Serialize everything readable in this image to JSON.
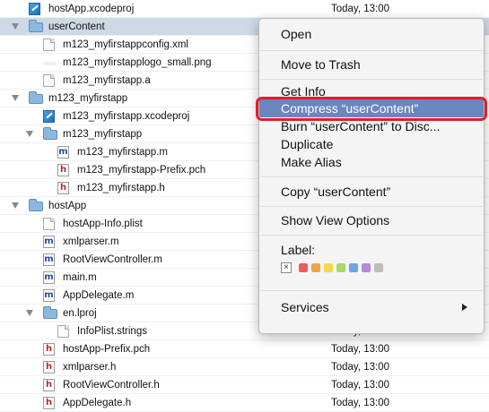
{
  "rows": [
    {
      "name": "hostApp.xcodeproj",
      "icon": "xcodeproj-icon",
      "date": "Today, 13:00",
      "indent": 0,
      "disclosure": "none"
    },
    {
      "name": "userContent",
      "icon": "folder-icon",
      "date": "",
      "indent": 0,
      "disclosure": "open",
      "selected": true
    },
    {
      "name": "m123_myfirstappconfig.xml",
      "icon": "document-icon",
      "date": "",
      "indent": 1,
      "disclosure": "none"
    },
    {
      "name": "m123_myfirstapplogo_small.png",
      "icon": "image-icon",
      "date": "",
      "indent": 1,
      "disclosure": "none"
    },
    {
      "name": "m123_myfirstapp.a",
      "icon": "document-icon",
      "date": "",
      "indent": 1,
      "disclosure": "none"
    },
    {
      "name": "m123_myfirstapp",
      "icon": "folder-icon",
      "date": "",
      "indent": 0,
      "disclosure": "open"
    },
    {
      "name": "m123_myfirstapp.xcodeproj",
      "icon": "xcodeproj-icon",
      "date": "",
      "indent": 1,
      "disclosure": "none"
    },
    {
      "name": "m123_myfirstapp",
      "icon": "folder-icon",
      "date": "",
      "indent": 1,
      "disclosure": "open"
    },
    {
      "name": "m123_myfirstapp.m",
      "icon": "m-file-icon",
      "date": "",
      "indent": 2,
      "disclosure": "none"
    },
    {
      "name": "m123_myfirstapp-Prefix.pch",
      "icon": "h-file-icon",
      "date": "",
      "indent": 2,
      "disclosure": "none"
    },
    {
      "name": "m123_myfirstapp.h",
      "icon": "h-file-icon",
      "date": "",
      "indent": 2,
      "disclosure": "none"
    },
    {
      "name": "hostApp",
      "icon": "folder-icon",
      "date": "",
      "indent": 0,
      "disclosure": "open"
    },
    {
      "name": "hostApp-Info.plist",
      "icon": "document-icon",
      "date": "",
      "indent": 1,
      "disclosure": "none"
    },
    {
      "name": "xmlparser.m",
      "icon": "m-file-icon",
      "date": "",
      "indent": 1,
      "disclosure": "none"
    },
    {
      "name": "RootViewController.m",
      "icon": "m-file-icon",
      "date": "",
      "indent": 1,
      "disclosure": "none"
    },
    {
      "name": "main.m",
      "icon": "m-file-icon",
      "date": "",
      "indent": 1,
      "disclosure": "none"
    },
    {
      "name": "AppDelegate.m",
      "icon": "m-file-icon",
      "date": "",
      "indent": 1,
      "disclosure": "none"
    },
    {
      "name": "en.lproj",
      "icon": "folder-icon",
      "date": "",
      "indent": 1,
      "disclosure": "open"
    },
    {
      "name": "InfoPlist.strings",
      "icon": "document-icon",
      "date": "Today, 13:00",
      "indent": 2,
      "disclosure": "none"
    },
    {
      "name": "hostApp-Prefix.pch",
      "icon": "h-file-icon",
      "date": "Today, 13:00",
      "indent": 1,
      "disclosure": "none"
    },
    {
      "name": "xmlparser.h",
      "icon": "h-file-icon",
      "date": "Today, 13:00",
      "indent": 1,
      "disclosure": "none"
    },
    {
      "name": "RootViewController.h",
      "icon": "h-file-icon",
      "date": "Today, 13:00",
      "indent": 1,
      "disclosure": "none"
    },
    {
      "name": "AppDelegate.h",
      "icon": "h-file-icon",
      "date": "Today, 13:00",
      "indent": 1,
      "disclosure": "none"
    }
  ],
  "icon_glyphs": {
    "m": "m",
    "h": "h"
  },
  "context_menu": {
    "items": [
      {
        "label": "Open"
      },
      {
        "label": "Move to Trash"
      },
      {
        "label": "Get Info"
      },
      {
        "label": "Compress “userContent”",
        "highlighted": true
      },
      {
        "label": "Burn “userContent” to Disc..."
      },
      {
        "label": "Duplicate"
      },
      {
        "label": "Make Alias"
      },
      {
        "label": "Copy “userContent”"
      },
      {
        "label": "Show View Options"
      },
      {
        "label": "Label:"
      },
      {
        "label": "Services",
        "submenu": true
      }
    ],
    "label_colors": [
      "#ef5b5b",
      "#f5a14a",
      "#f2d84a",
      "#a7d86a",
      "#6aa7e8",
      "#b38ad9",
      "#bdbdbd"
    ],
    "highlight_color": "#6a86c0",
    "highlight_ring_color": "#e01f28"
  }
}
